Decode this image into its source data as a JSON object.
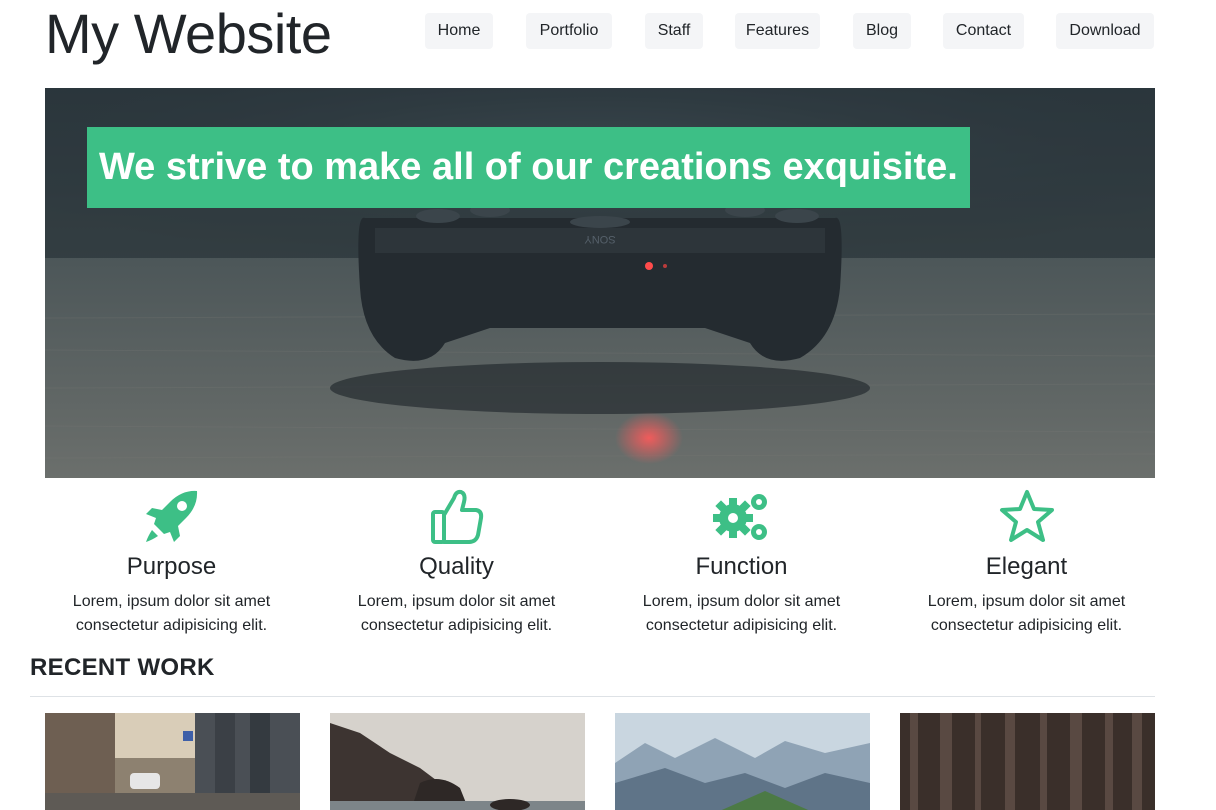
{
  "brand": {
    "title": "My Website"
  },
  "nav": {
    "items": [
      {
        "label": "Home"
      },
      {
        "label": "Portfolio"
      },
      {
        "label": "Staff"
      },
      {
        "label": "Features"
      },
      {
        "label": "Blog"
      },
      {
        "label": "Contact"
      },
      {
        "label": "Download"
      }
    ]
  },
  "hero": {
    "headline": "We strive to make all of our creations exquisite.",
    "controller_brand": "SONY"
  },
  "features": [
    {
      "icon": "rocket-icon",
      "title": "Purpose",
      "text_line1": "Lorem, ipsum dolor sit amet",
      "text_line2": "consectetur adipisicing elit."
    },
    {
      "icon": "thumbs-up-icon",
      "title": "Quality",
      "text_line1": "Lorem, ipsum dolor sit amet",
      "text_line2": "consectetur adipisicing elit."
    },
    {
      "icon": "gears-icon",
      "title": "Function",
      "text_line1": "Lorem, ipsum dolor sit amet",
      "text_line2": "consectetur adipisicing elit."
    },
    {
      "icon": "star-icon",
      "title": "Elegant",
      "text_line1": "Lorem, ipsum dolor sit amet",
      "text_line2": "consectetur adipisicing elit."
    }
  ],
  "recent_work": {
    "title": "RECENT WORK"
  },
  "colors": {
    "accent": "#3dbf86",
    "text": "#212529",
    "nav_bg": "#f4f5f7"
  }
}
